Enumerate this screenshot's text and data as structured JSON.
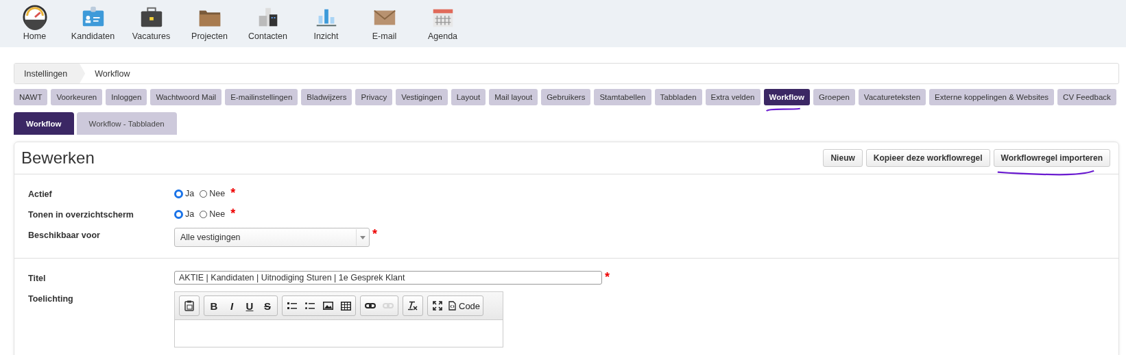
{
  "nav": [
    {
      "label": "Home"
    },
    {
      "label": "Kandidaten"
    },
    {
      "label": "Vacatures"
    },
    {
      "label": "Projecten"
    },
    {
      "label": "Contacten"
    },
    {
      "label": "Inzicht"
    },
    {
      "label": "E-mail"
    },
    {
      "label": "Agenda"
    }
  ],
  "breadcrumb": [
    "Instellingen",
    "Workflow"
  ],
  "tabs": [
    {
      "label": "NAWT",
      "selected": false,
      "marked": false
    },
    {
      "label": "Voorkeuren",
      "selected": false,
      "marked": false
    },
    {
      "label": "Inloggen",
      "selected": false,
      "marked": false
    },
    {
      "label": "Wachtwoord Mail",
      "selected": false,
      "marked": false
    },
    {
      "label": "E-mailinstellingen",
      "selected": false,
      "marked": false
    },
    {
      "label": "Bladwijzers",
      "selected": false,
      "marked": false
    },
    {
      "label": "Privacy",
      "selected": false,
      "marked": false
    },
    {
      "label": "Vestigingen",
      "selected": false,
      "marked": false
    },
    {
      "label": "Layout",
      "selected": false,
      "marked": false
    },
    {
      "label": "Mail layout",
      "selected": false,
      "marked": false
    },
    {
      "label": "Gebruikers",
      "selected": false,
      "marked": false
    },
    {
      "label": "Stamtabellen",
      "selected": false,
      "marked": false
    },
    {
      "label": "Tabbladen",
      "selected": false,
      "marked": false
    },
    {
      "label": "Extra velden",
      "selected": false,
      "marked": false
    },
    {
      "label": "Workflow",
      "selected": true,
      "marked": true
    },
    {
      "label": "Groepen",
      "selected": false,
      "marked": false
    },
    {
      "label": "Vacatureteksten",
      "selected": false,
      "marked": false
    },
    {
      "label": "Externe koppelingen & Websites",
      "selected": false,
      "marked": false
    },
    {
      "label": "CV Feedback",
      "selected": false,
      "marked": false
    }
  ],
  "subtabs": [
    {
      "label": "Workflow",
      "selected": true
    },
    {
      "label": "Workflow - Tabbladen",
      "selected": false
    }
  ],
  "panel": {
    "title": "Bewerken",
    "buttons": [
      {
        "label": "Nieuw",
        "marked": false
      },
      {
        "label": "Kopieer deze workflowregel",
        "marked": false
      },
      {
        "label": "Workflowregel importeren",
        "marked": true
      }
    ],
    "section_1": [
      {
        "kind": "radio",
        "label": "Actief",
        "required_mark": "*",
        "options": [
          {
            "label": "Ja",
            "selected": true
          },
          {
            "label": "Nee",
            "selected": false
          }
        ]
      },
      {
        "kind": "radio",
        "label": "Tonen in overzichtscherm",
        "required_mark": "*",
        "options": [
          {
            "label": "Ja",
            "selected": true
          },
          {
            "label": "Nee",
            "selected": false
          }
        ]
      },
      {
        "kind": "select",
        "label": "Beschikbaar voor",
        "required_mark": "*",
        "value": "Alle vestigingen"
      }
    ],
    "section_2": [
      {
        "kind": "text",
        "label": "Titel",
        "required_mark": "*",
        "value": "AKTIE | Kandidaten | Uitnodiging Sturen | 1e Gesprek Klant"
      },
      {
        "kind": "editor",
        "label": "Toelichting",
        "toolbar": [
          [
            {
              "kind": "paste-word",
              "disabled": false
            }
          ],
          [
            {
              "kind": "bold",
              "text": "B",
              "disabled": false
            },
            {
              "kind": "italic",
              "text": "I",
              "disabled": false
            },
            {
              "kind": "underline",
              "text": "U",
              "disabled": false
            },
            {
              "kind": "strike",
              "text": "S",
              "disabled": false
            }
          ],
          [
            {
              "kind": "numbered-list",
              "disabled": false
            },
            {
              "kind": "bulleted-list",
              "disabled": false
            },
            {
              "kind": "image",
              "disabled": false
            },
            {
              "kind": "table",
              "disabled": false
            }
          ],
          [
            {
              "kind": "link",
              "disabled": false
            },
            {
              "kind": "unlink",
              "disabled": true
            }
          ],
          [
            {
              "kind": "clear-format",
              "disabled": false
            }
          ],
          [
            {
              "kind": "maximize",
              "disabled": false
            },
            {
              "kind": "source",
              "text": "Code",
              "disabled": false
            }
          ]
        ]
      }
    ]
  }
}
